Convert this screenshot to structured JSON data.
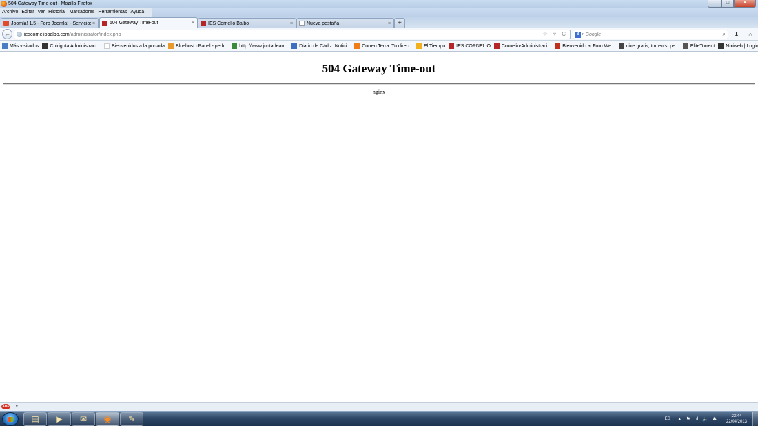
{
  "window": {
    "title": "504 Gateway Time-out - Mozilla Firefox",
    "controls": {
      "minimize": "–",
      "maximize": "□",
      "close": "✕"
    }
  },
  "menu": [
    "Archivo",
    "Editar",
    "Ver",
    "Historial",
    "Marcadores",
    "Herramientas",
    "Ayuda"
  ],
  "tabs": [
    {
      "label": "Joomla! 1.5 - Foro Joomla! - Servicios ...",
      "close": "×",
      "favicon": "joomla-icon"
    },
    {
      "label": "504 Gateway Time-out",
      "close": "×",
      "favicon": "ies-logo-icon"
    },
    {
      "label": "IES Cornelio Balbo",
      "close": "×",
      "favicon": "ies-logo-icon"
    },
    {
      "label": "Nueva pestaña",
      "close": "×",
      "favicon": "blank-page-icon"
    }
  ],
  "newtab": "+",
  "nav": {
    "back": "←",
    "url_host": "iescorneliobalbo.com",
    "url_path": "/administrator/index.php",
    "url_right": "☆ ▿ C",
    "search_engine": "8",
    "search_caret": "▾",
    "search_placeholder": "Google",
    "search_button": "⌕",
    "download": "⬇",
    "home": "⌂"
  },
  "bookmarks": [
    {
      "label": "Más visitados",
      "icon": "bookmarks-icon",
      "color": "#4a7cc4"
    },
    {
      "label": "Chirigota Administraci...",
      "icon": "site-icon",
      "color": "#333333"
    },
    {
      "label": "Bienvenidos a la portada",
      "icon": "blank-icon",
      "color": "#ffffff"
    },
    {
      "label": "Bluehost cPanel - pedr...",
      "icon": "cpanel-icon",
      "color": "#e89a2e"
    },
    {
      "label": "http://www.juntadean...",
      "icon": "junta-icon",
      "color": "#3a8a3a"
    },
    {
      "label": "Diario de Cádiz. Notici...",
      "icon": "newspaper-icon",
      "color": "#3d6fc2"
    },
    {
      "label": "Correo Terra. Tu direc...",
      "icon": "terra-icon",
      "color": "#ee7d1a"
    },
    {
      "label": "El Tiempo",
      "icon": "weather-icon",
      "color": "#f2b21f"
    },
    {
      "label": "IES CORNELIO",
      "icon": "ies-logo-icon",
      "color": "#b52626"
    },
    {
      "label": "Cornelio-Administraci...",
      "icon": "ies-logo-icon",
      "color": "#b52626"
    },
    {
      "label": "Bienvenido al Foro We...",
      "icon": "forum-icon",
      "color": "#c0311d"
    },
    {
      "label": "cine gratis, torrents, pe...",
      "icon": "film-icon",
      "color": "#444444"
    },
    {
      "label": "EliteTorrent",
      "icon": "signal-icon",
      "color": "#555555"
    },
    {
      "label": "Nixiweb | Login",
      "icon": "lightning-icon",
      "color": "#333333"
    }
  ],
  "page": {
    "heading": "504 Gateway Time-out",
    "server": "nginx"
  },
  "addonbar": {
    "abp_label": "ABP",
    "close": "×"
  },
  "taskbar": {
    "items": [
      {
        "name": "explorer",
        "glyph": "▤",
        "active": false
      },
      {
        "name": "media-player",
        "glyph": "▶",
        "active": false
      },
      {
        "name": "thunderbird",
        "glyph": "✉",
        "active": false
      },
      {
        "name": "firefox",
        "glyph": "◉",
        "active": true
      },
      {
        "name": "paint",
        "glyph": "✎",
        "active": false
      }
    ],
    "language": "ES",
    "tray_icons": [
      "▲",
      "⚑",
      ".ıl",
      "🔈",
      "✱"
    ],
    "time": "23:44",
    "date": "22/04/2013"
  },
  "colors": {
    "accent": "#2b4c8c",
    "close_button": "#c7412a"
  }
}
